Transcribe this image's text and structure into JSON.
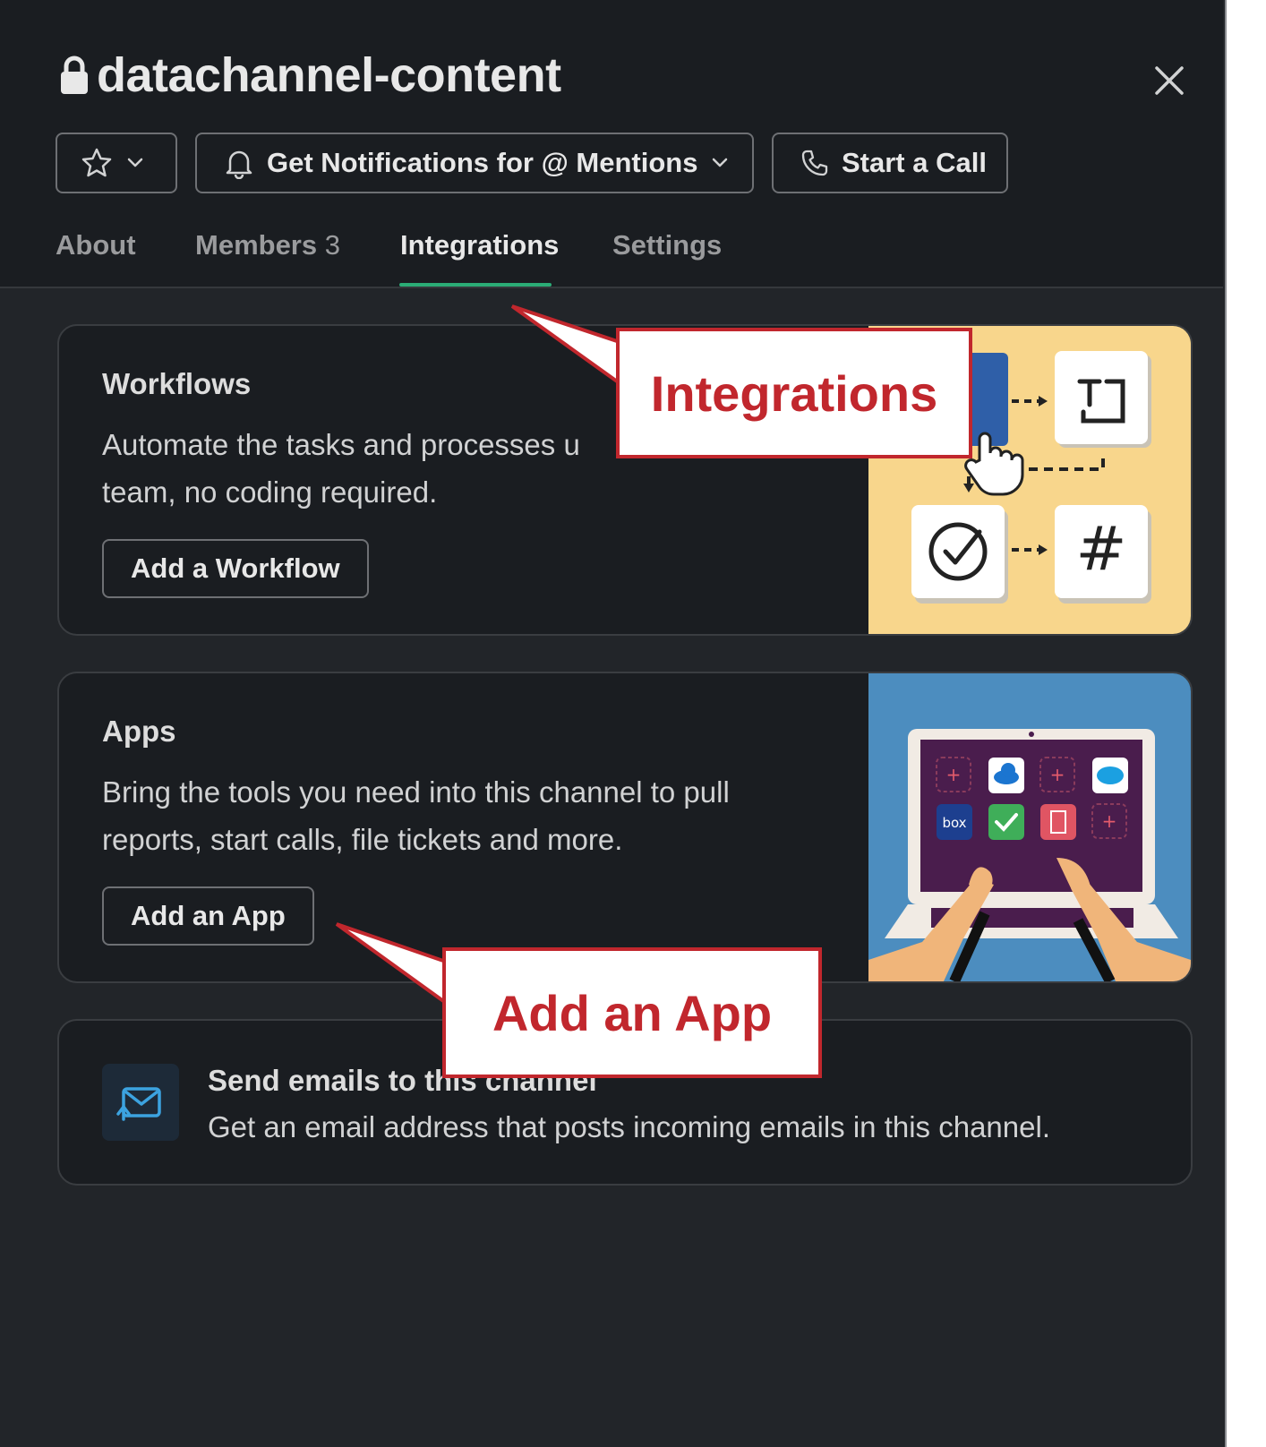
{
  "channel": {
    "name": "datachannel-content"
  },
  "toolbar": {
    "notifications_label": "Get Notifications for @ Mentions",
    "call_label": "Start a Call"
  },
  "tabs": [
    {
      "label": "About"
    },
    {
      "label": "Members",
      "count": "3"
    },
    {
      "label": "Integrations",
      "active": true
    },
    {
      "label": "Settings"
    }
  ],
  "workflows": {
    "title": "Workflows",
    "description": "Automate the tasks and processes unique to your team, no coding required.",
    "description_line1": "Automate the tasks and processes u",
    "description_line2": "team, no coding required.",
    "button": "Add a Workflow"
  },
  "apps": {
    "title": "Apps",
    "description_line1": "Bring the tools you need into this channel to pull",
    "description_line2": "reports, start calls, file tickets and more.",
    "button": "Add an App",
    "illustration_labels": [
      "box"
    ]
  },
  "email": {
    "title": "Send emails to this channel",
    "description": "Get an email address that posts incoming emails in this channel."
  },
  "callouts": {
    "integrations": "Integrations",
    "add_app": "Add an App"
  },
  "colors": {
    "background": "#222529",
    "header": "#1a1d21",
    "tab_underline": "#2bac76",
    "callout_red": "#c1272d",
    "workflow_illustration": "#f8d68c",
    "apps_illustration": "#4c8dbf"
  }
}
